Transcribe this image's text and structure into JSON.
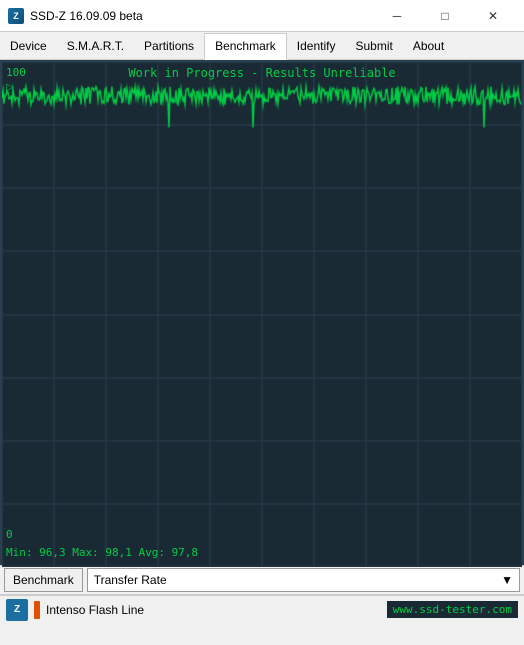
{
  "window": {
    "title": "SSD-Z 16.09.09 beta",
    "controls": {
      "minimize": "─",
      "maximize": "□",
      "close": "✕"
    }
  },
  "menu": {
    "items": [
      {
        "id": "device",
        "label": "Device",
        "active": false
      },
      {
        "id": "smart",
        "label": "S.M.A.R.T.",
        "active": false
      },
      {
        "id": "partitions",
        "label": "Partitions",
        "active": false
      },
      {
        "id": "benchmark",
        "label": "Benchmark",
        "active": true
      },
      {
        "id": "identify",
        "label": "Identify",
        "active": false
      },
      {
        "id": "submit",
        "label": "Submit",
        "active": false
      },
      {
        "id": "about",
        "label": "About",
        "active": false
      }
    ]
  },
  "chart": {
    "label_top": "100",
    "label_bottom": "0",
    "status_text": "Work in Progress - Results Unreliable",
    "stats_text": "Min: 96,3  Max: 98,1  Avg: 97,8",
    "play_symbol": "▷",
    "bg_color": "#1a2a35",
    "grid_color": "#2a4050",
    "line_color": "#00cc44"
  },
  "bottom_bar": {
    "benchmark_btn": "Benchmark",
    "dropdown_label": "Transfer Rate",
    "dropdown_arrow": "▼"
  },
  "status_bar": {
    "drive_name": "Intenso Flash Line",
    "website": "www.ssd-tester.com"
  }
}
